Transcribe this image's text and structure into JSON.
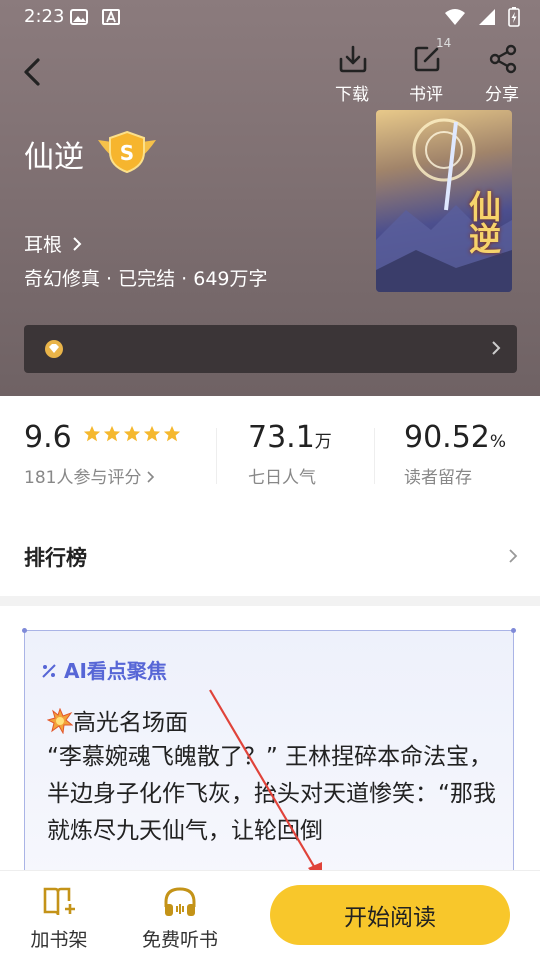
{
  "status_bar": {
    "time": "2:23"
  },
  "header": {
    "actions": [
      {
        "label": "下载",
        "icon": "download-icon"
      },
      {
        "label": "书评",
        "icon": "edit-review-icon",
        "count": "14"
      },
      {
        "label": "分享",
        "icon": "share-icon"
      }
    ]
  },
  "book": {
    "title": "仙逆",
    "badge_letter": "S",
    "author": "耳根",
    "meta": "奇幻修真 · 已完结 · 649万字",
    "cover_title": "仙逆"
  },
  "stats": {
    "rating": {
      "value": "9.6",
      "sub": "181人参与评分",
      "stars": 5
    },
    "popularity": {
      "value": "73.1",
      "unit": "万",
      "sub": "七日人气"
    },
    "retention": {
      "value": "90.52",
      "unit": "%",
      "sub": "读者留存"
    }
  },
  "ranking": {
    "label": "排行榜"
  },
  "ai_focus": {
    "title": "AI看点聚焦",
    "heading": "高光名场面",
    "body": "“李慕婉魂飞魄散了？” 王林捏碎本命法宝，半边身子化作飞灰，抬头对天道惨笑：“那我就炼尽九天仙气，让轮回倒"
  },
  "bottom_bar": {
    "bookshelf": "加书架",
    "listen": "免费听书",
    "read": "开始阅读"
  },
  "colors": {
    "accent": "#f8c72b",
    "ai": "#5766d6",
    "star": "#f5b82e"
  }
}
